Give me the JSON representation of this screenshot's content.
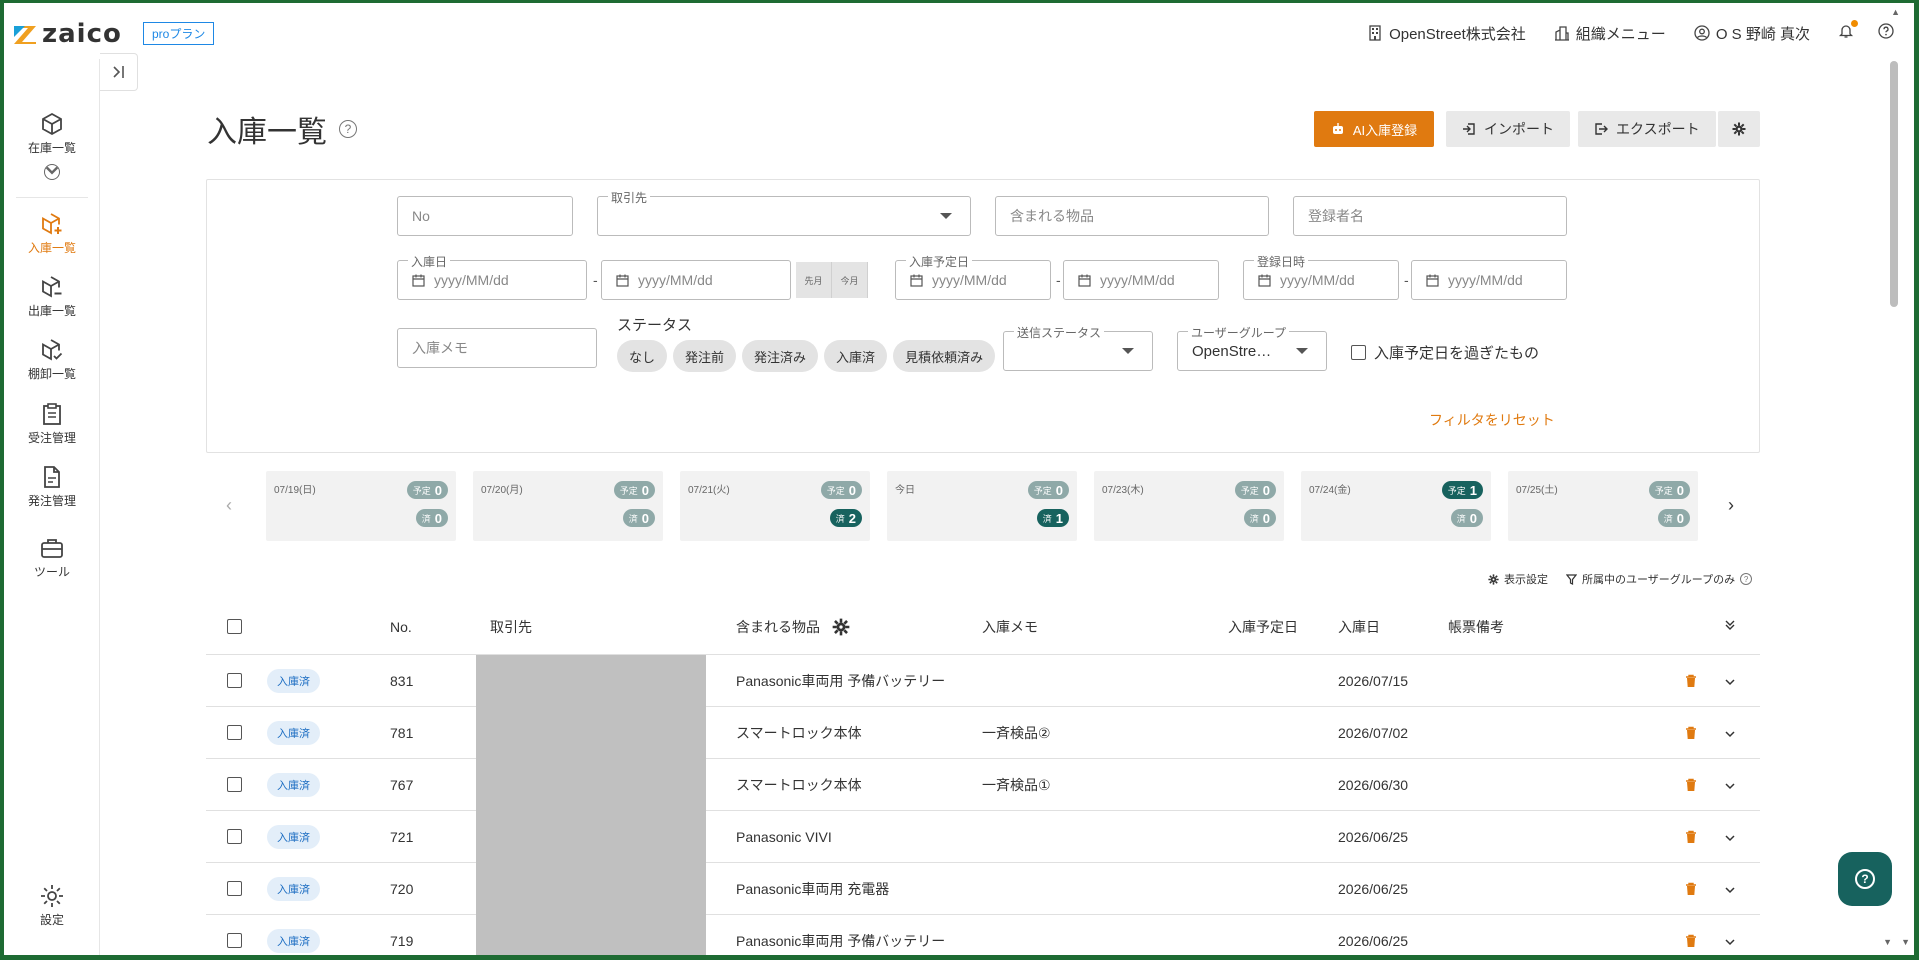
{
  "brand": {
    "logo_text": "zaico",
    "plan": "proプラン"
  },
  "header": {
    "company": "OpenStreet株式会社",
    "org_menu": "組織メニュー",
    "user": "O S 野崎 真次"
  },
  "sidebar": {
    "items": [
      {
        "label": "在庫一覧"
      },
      {
        "label": "入庫一覧"
      },
      {
        "label": "出庫一覧"
      },
      {
        "label": "棚卸一覧"
      },
      {
        "label": "受注管理"
      },
      {
        "label": "発注管理"
      },
      {
        "label": "ツール"
      },
      {
        "label": "設定"
      }
    ]
  },
  "page": {
    "title": "入庫一覧"
  },
  "actions": {
    "ai_register": "AI入庫登録",
    "import": "インポート",
    "export": "エクスポート"
  },
  "filters": {
    "no_placeholder": "No",
    "supplier_label": "取引先",
    "items_placeholder": "含まれる物品",
    "registrant_placeholder": "登録者名",
    "received_date_label": "入庫日",
    "planned_date_label": "入庫予定日",
    "registered_at_label": "登録日時",
    "date_placeholder": "yyyy/MM/dd",
    "last_month": "先月",
    "this_month": "今月",
    "memo_placeholder": "入庫メモ",
    "status_label": "ステータス",
    "statuses": [
      "なし",
      "発注前",
      "発注済み",
      "入庫済",
      "見積依頼済み"
    ],
    "send_status_label": "送信ステータス",
    "user_group_label": "ユーザーグループ",
    "user_group_value": "OpenStre…",
    "overdue_label": "入庫予定日を過ぎたもの",
    "reset": "フィルタをリセット"
  },
  "calendar": {
    "planned_label": "予定",
    "done_label": "済",
    "days": [
      {
        "date": "07/19(日)",
        "planned": "0",
        "done": "0",
        "planned_active": false,
        "done_active": false
      },
      {
        "date": "07/20(月)",
        "planned": "0",
        "done": "0",
        "planned_active": false,
        "done_active": false
      },
      {
        "date": "07/21(火)",
        "planned": "0",
        "done": "2",
        "planned_active": false,
        "done_active": true
      },
      {
        "date": "今日",
        "planned": "0",
        "done": "1",
        "planned_active": false,
        "done_active": true
      },
      {
        "date": "07/23(木)",
        "planned": "0",
        "done": "0",
        "planned_active": false,
        "done_active": false
      },
      {
        "date": "07/24(金)",
        "planned": "1",
        "done": "0",
        "planned_active": true,
        "done_active": false
      },
      {
        "date": "07/25(土)",
        "planned": "0",
        "done": "0",
        "planned_active": false,
        "done_active": false
      }
    ]
  },
  "table_options": {
    "display_settings": "表示設定",
    "own_group_only": "所属中のユーザーグループのみ"
  },
  "table": {
    "columns": {
      "no": "No.",
      "supplier": "取引先",
      "items": "含まれる物品",
      "memo": "入庫メモ",
      "planned_date": "入庫予定日",
      "received_date": "入庫日",
      "remarks": "帳票備考"
    },
    "rows": [
      {
        "status": "入庫済",
        "no": "831",
        "items": "Panasonic車両用 予備バッテリー",
        "memo": "",
        "received_date": "2026/07/15"
      },
      {
        "status": "入庫済",
        "no": "781",
        "items": "スマートロック本体",
        "memo": "一斉検品②",
        "received_date": "2026/07/02"
      },
      {
        "status": "入庫済",
        "no": "767",
        "items": "スマートロック本体",
        "memo": "一斉検品①",
        "received_date": "2026/06/30"
      },
      {
        "status": "入庫済",
        "no": "721",
        "items": "Panasonic VIVI",
        "memo": "",
        "received_date": "2026/06/25"
      },
      {
        "status": "入庫済",
        "no": "720",
        "items": "Panasonic車両用 充電器",
        "memo": "",
        "received_date": "2026/06/25"
      },
      {
        "status": "入庫済",
        "no": "719",
        "items": "Panasonic車両用 予備バッテリー",
        "memo": "",
        "received_date": "2026/06/25"
      }
    ]
  },
  "colors": {
    "accent": "#e07a10",
    "teal": "#17625e",
    "badge_blue": "#1c6dc2"
  }
}
